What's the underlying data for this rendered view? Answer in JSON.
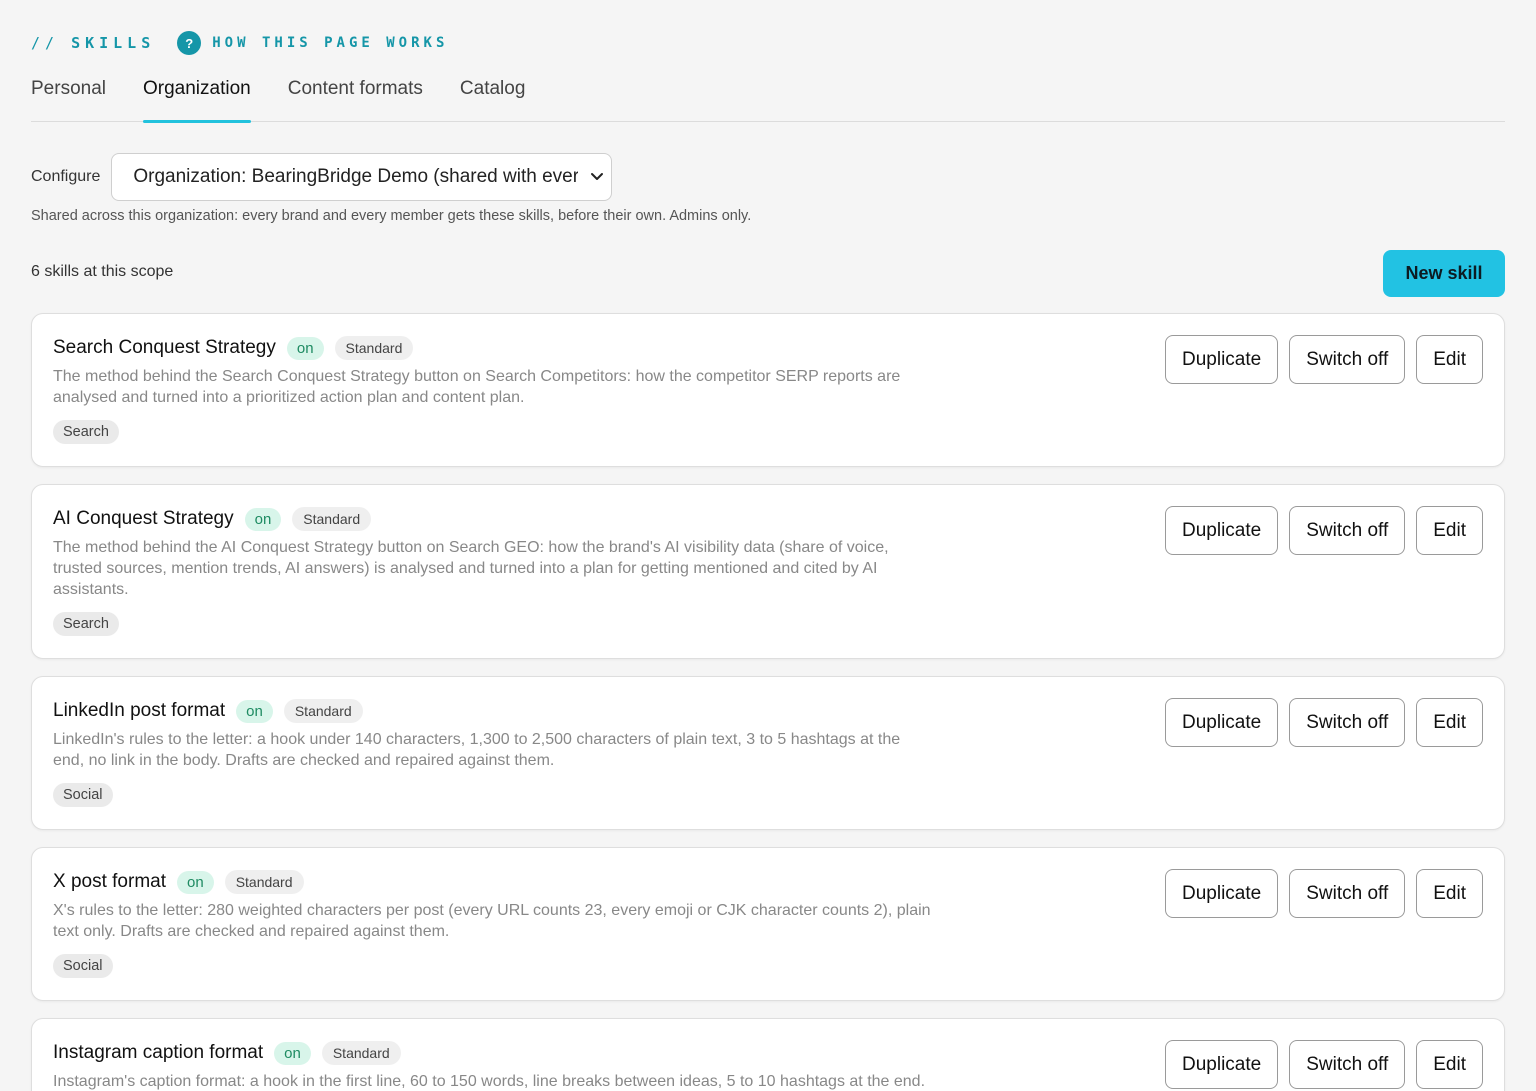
{
  "header": {
    "slashes": "//",
    "section": "SKILLS",
    "help_icon": "?",
    "help_link": "HOW THIS PAGE WORKS"
  },
  "tabs": [
    {
      "label": "Personal",
      "active": false
    },
    {
      "label": "Organization",
      "active": true
    },
    {
      "label": "Content formats",
      "active": false
    },
    {
      "label": "Catalog",
      "active": false
    }
  ],
  "configure": {
    "label": "Configure",
    "selected": "Organization: BearingBridge Demo (shared with everyone)",
    "icon": "chevron-down-icon"
  },
  "scope_note": "Shared across this organization: every brand and every member gets these skills, before their own. Admins only.",
  "count_text": "6 skills at this scope",
  "new_skill_label": "New skill",
  "colors": {
    "accent": "#22c2e3",
    "accent_text": "#1596a8",
    "on_badge_bg": "#d8f5ea",
    "on_badge_text": "#1e8b62"
  },
  "actions": {
    "duplicate": "Duplicate",
    "switch_off": "Switch off",
    "edit": "Edit"
  },
  "skills": [
    {
      "title": "Search Conquest Strategy",
      "status": "on",
      "kind": "Standard",
      "description": "The method behind the Search Conquest Strategy button on Search Competitors: how the competitor SERP reports are analysed and turned into a prioritized action plan and content plan.",
      "tag": "Search"
    },
    {
      "title": "AI Conquest Strategy",
      "status": "on",
      "kind": "Standard",
      "description": "The method behind the AI Conquest Strategy button on Search GEO: how the brand's AI visibility data (share of voice, trusted sources, mention trends, AI answers) is analysed and turned into a plan for getting mentioned and cited by AI assistants.",
      "tag": "Search"
    },
    {
      "title": "LinkedIn post format",
      "status": "on",
      "kind": "Standard",
      "description": "LinkedIn's rules to the letter: a hook under 140 characters, 1,300 to 2,500 characters of plain text, 3 to 5 hashtags at the end, no link in the body. Drafts are checked and repaired against them.",
      "tag": "Social"
    },
    {
      "title": "X post format",
      "status": "on",
      "kind": "Standard",
      "description": "X's rules to the letter: 280 weighted characters per post (every URL counts 23, every emoji or CJK character counts 2), plain text only. Drafts are checked and repaired against them.",
      "tag": "Social"
    },
    {
      "title": "Instagram caption format",
      "status": "on",
      "kind": "Standard",
      "description": "Instagram's caption format: a hook in the first line, 60 to 150 words, line breaks between ideas, 5 to 10 hashtags at the end.",
      "tag": ""
    }
  ]
}
